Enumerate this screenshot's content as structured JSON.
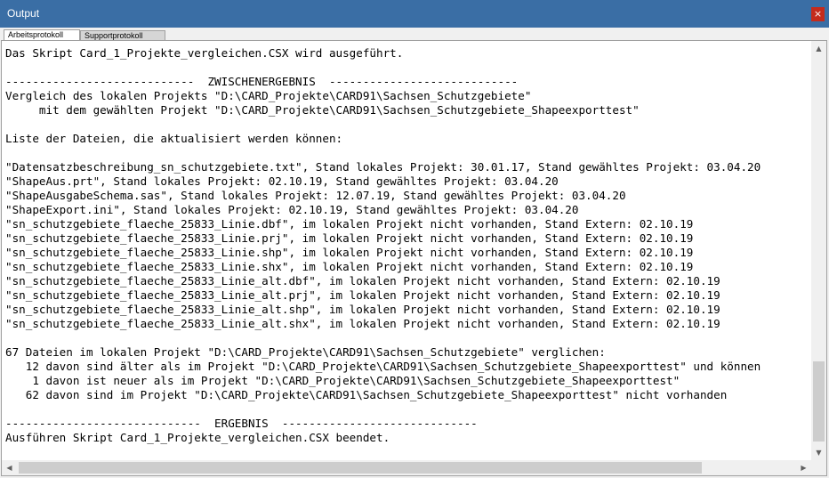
{
  "window": {
    "title": "Output",
    "close_glyph": "×",
    "accent": "#3a6ea5",
    "close_color": "#c42b1c"
  },
  "tabs": [
    {
      "label": "Arbeitsprotokoll",
      "active": true
    },
    {
      "label": "Supportprotokoll",
      "active": false
    }
  ],
  "log": {
    "lines": [
      "Das Skript Card_1_Projekte_vergleichen.CSX wird ausgeführt.",
      "",
      "----------------------------  ZWISCHENERGEBNIS  ----------------------------",
      "Vergleich des lokalen Projekts \"D:\\CARD_Projekte\\CARD91\\Sachsen_Schutzgebiete\"",
      "     mit dem gewählten Projekt \"D:\\CARD_Projekte\\CARD91\\Sachsen_Schutzgebiete_Shapeexporttest\"",
      "",
      "Liste der Dateien, die aktualisiert werden können:",
      "",
      "\"Datensatzbeschreibung_sn_schutzgebiete.txt\", Stand lokales Projekt: 30.01.17, Stand gewähltes Projekt: 03.04.20",
      "\"ShapeAus.prt\", Stand lokales Projekt: 02.10.19, Stand gewähltes Projekt: 03.04.20",
      "\"ShapeAusgabeSchema.sas\", Stand lokales Projekt: 12.07.19, Stand gewähltes Projekt: 03.04.20",
      "\"ShapeExport.ini\", Stand lokales Projekt: 02.10.19, Stand gewähltes Projekt: 03.04.20",
      "\"sn_schutzgebiete_flaeche_25833_Linie.dbf\", im lokalen Projekt nicht vorhanden, Stand Extern: 02.10.19",
      "\"sn_schutzgebiete_flaeche_25833_Linie.prj\", im lokalen Projekt nicht vorhanden, Stand Extern: 02.10.19",
      "\"sn_schutzgebiete_flaeche_25833_Linie.shp\", im lokalen Projekt nicht vorhanden, Stand Extern: 02.10.19",
      "\"sn_schutzgebiete_flaeche_25833_Linie.shx\", im lokalen Projekt nicht vorhanden, Stand Extern: 02.10.19",
      "\"sn_schutzgebiete_flaeche_25833_Linie_alt.dbf\", im lokalen Projekt nicht vorhanden, Stand Extern: 02.10.19",
      "\"sn_schutzgebiete_flaeche_25833_Linie_alt.prj\", im lokalen Projekt nicht vorhanden, Stand Extern: 02.10.19",
      "\"sn_schutzgebiete_flaeche_25833_Linie_alt.shp\", im lokalen Projekt nicht vorhanden, Stand Extern: 02.10.19",
      "\"sn_schutzgebiete_flaeche_25833_Linie_alt.shx\", im lokalen Projekt nicht vorhanden, Stand Extern: 02.10.19",
      "",
      "67 Dateien im lokalen Projekt \"D:\\CARD_Projekte\\CARD91\\Sachsen_Schutzgebiete\" verglichen:",
      "   12 davon sind älter als im Projekt \"D:\\CARD_Projekte\\CARD91\\Sachsen_Schutzgebiete_Shapeexporttest\" und können",
      "    1 davon ist neuer als im Projekt \"D:\\CARD_Projekte\\CARD91\\Sachsen_Schutzgebiete_Shapeexporttest\"",
      "   62 davon sind im Projekt \"D:\\CARD_Projekte\\CARD91\\Sachsen_Schutzgebiete_Shapeexporttest\" nicht vorhanden",
      "",
      "-----------------------------  ERGEBNIS  -----------------------------",
      "Ausführen Skript Card_1_Projekte_vergleichen.CSX beendet."
    ]
  },
  "scrollbars": {
    "up_glyph": "▲",
    "down_glyph": "▼",
    "left_glyph": "◀",
    "right_glyph": "▶"
  }
}
